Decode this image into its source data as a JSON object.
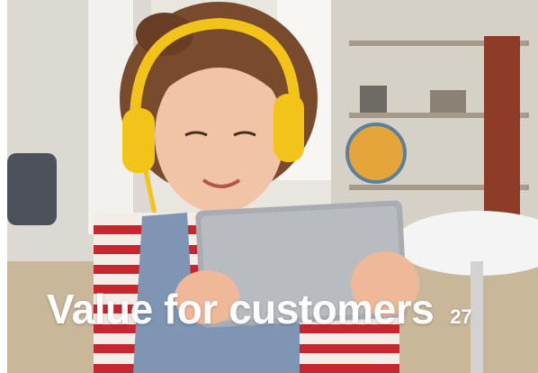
{
  "slide": {
    "title": "Value for customers",
    "page_number": "27"
  },
  "photo": {
    "subject": "child-with-headphones-and-tablet"
  },
  "colors": {
    "headphones": "#f2c319",
    "tablet": "#a9adb3",
    "wall": "#ece9e3",
    "shirt_red": "#c8262f",
    "denim": "#7e95b4",
    "title_text": "#ffffff"
  }
}
